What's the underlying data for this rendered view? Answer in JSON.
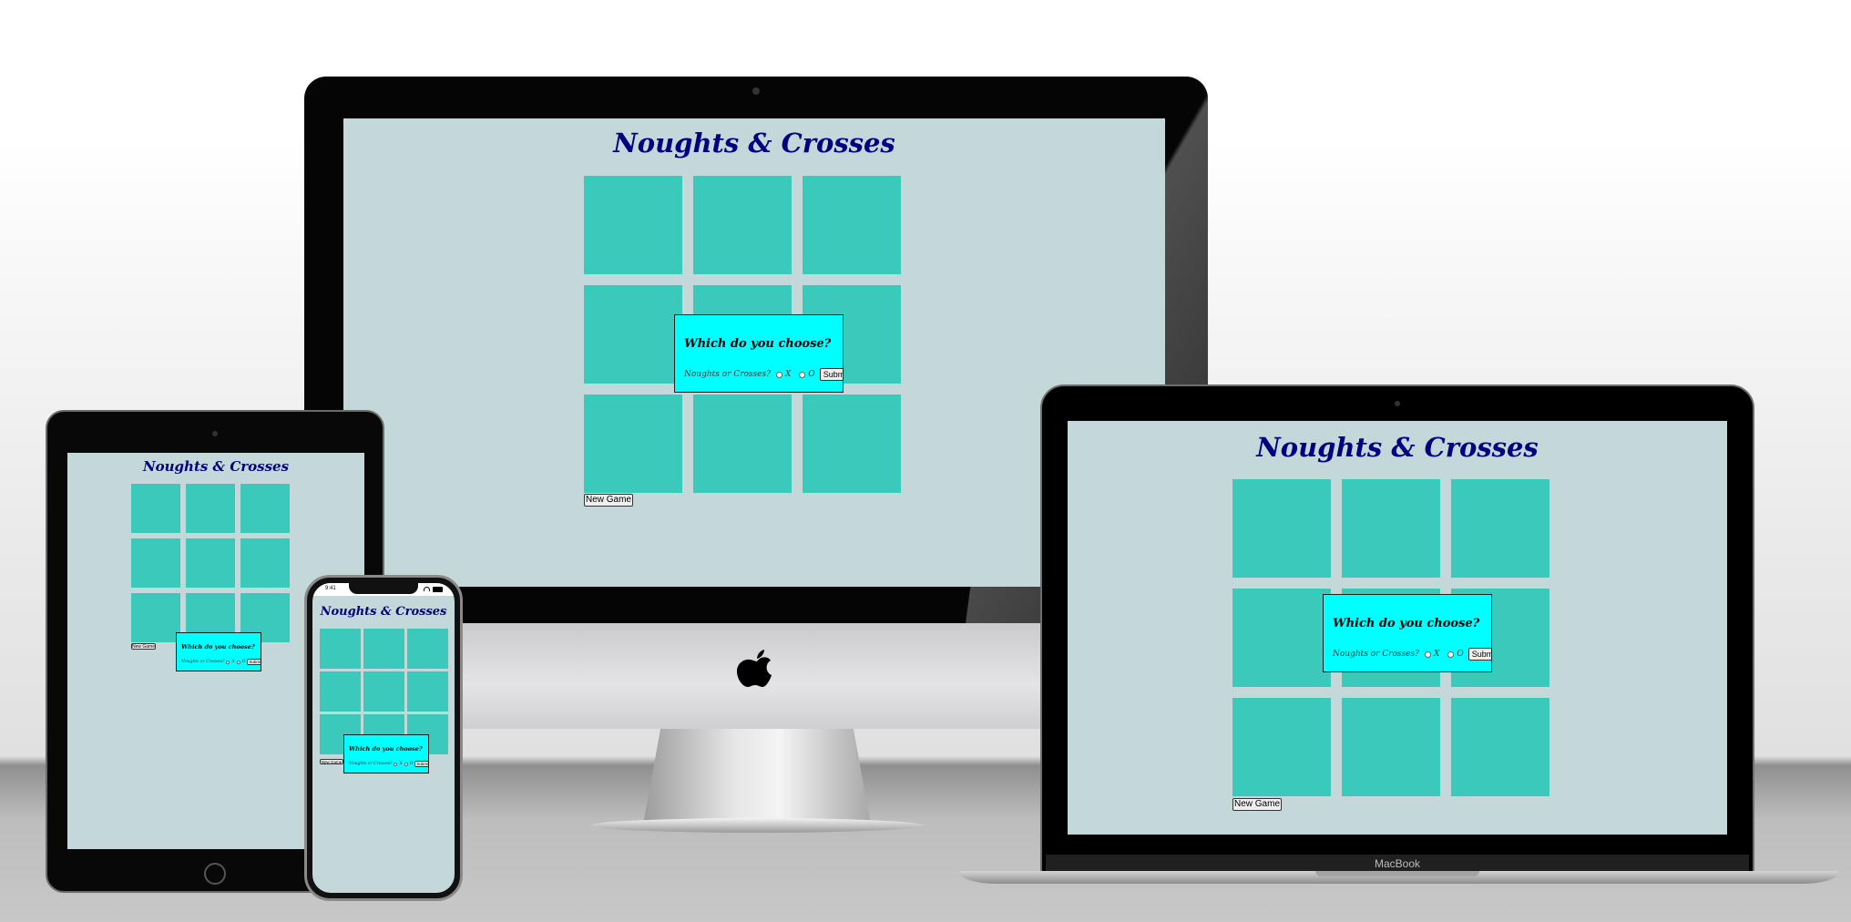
{
  "game": {
    "title": "Noughts & Crosses",
    "modal_heading": "Which do you choose?",
    "modal_prompt": "Noughts or Crosses?",
    "option_x": "X",
    "option_o": "O",
    "submit_label": "Submit",
    "new_game_label": "New Game"
  },
  "devices": {
    "laptop_brand": "MacBook",
    "phone_time": "9:41"
  },
  "colors": {
    "page_background": "#c4d8d9",
    "title": "#000080",
    "tile": "#3ac9ba",
    "modal": "#00ffff"
  }
}
